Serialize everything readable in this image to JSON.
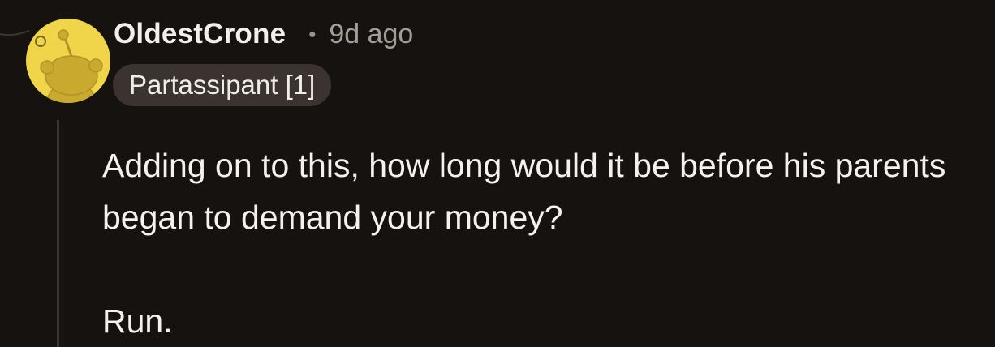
{
  "comment": {
    "author": "OldestCrone",
    "separator": "•",
    "age": "9d ago",
    "flair": "Partassipant [1]",
    "paragraphs": [
      "Adding on to this, how long would it be before his parents began to demand your money?",
      "Run."
    ]
  },
  "avatar": {
    "icon": "snoo-avatar-icon",
    "background_color": "#f0d54a",
    "figure_color": "#c9a92e"
  },
  "colors": {
    "background": "#161210",
    "thread_line": "#3a3633",
    "flair_background": "#3a3330",
    "muted_text": "#a39d96"
  }
}
